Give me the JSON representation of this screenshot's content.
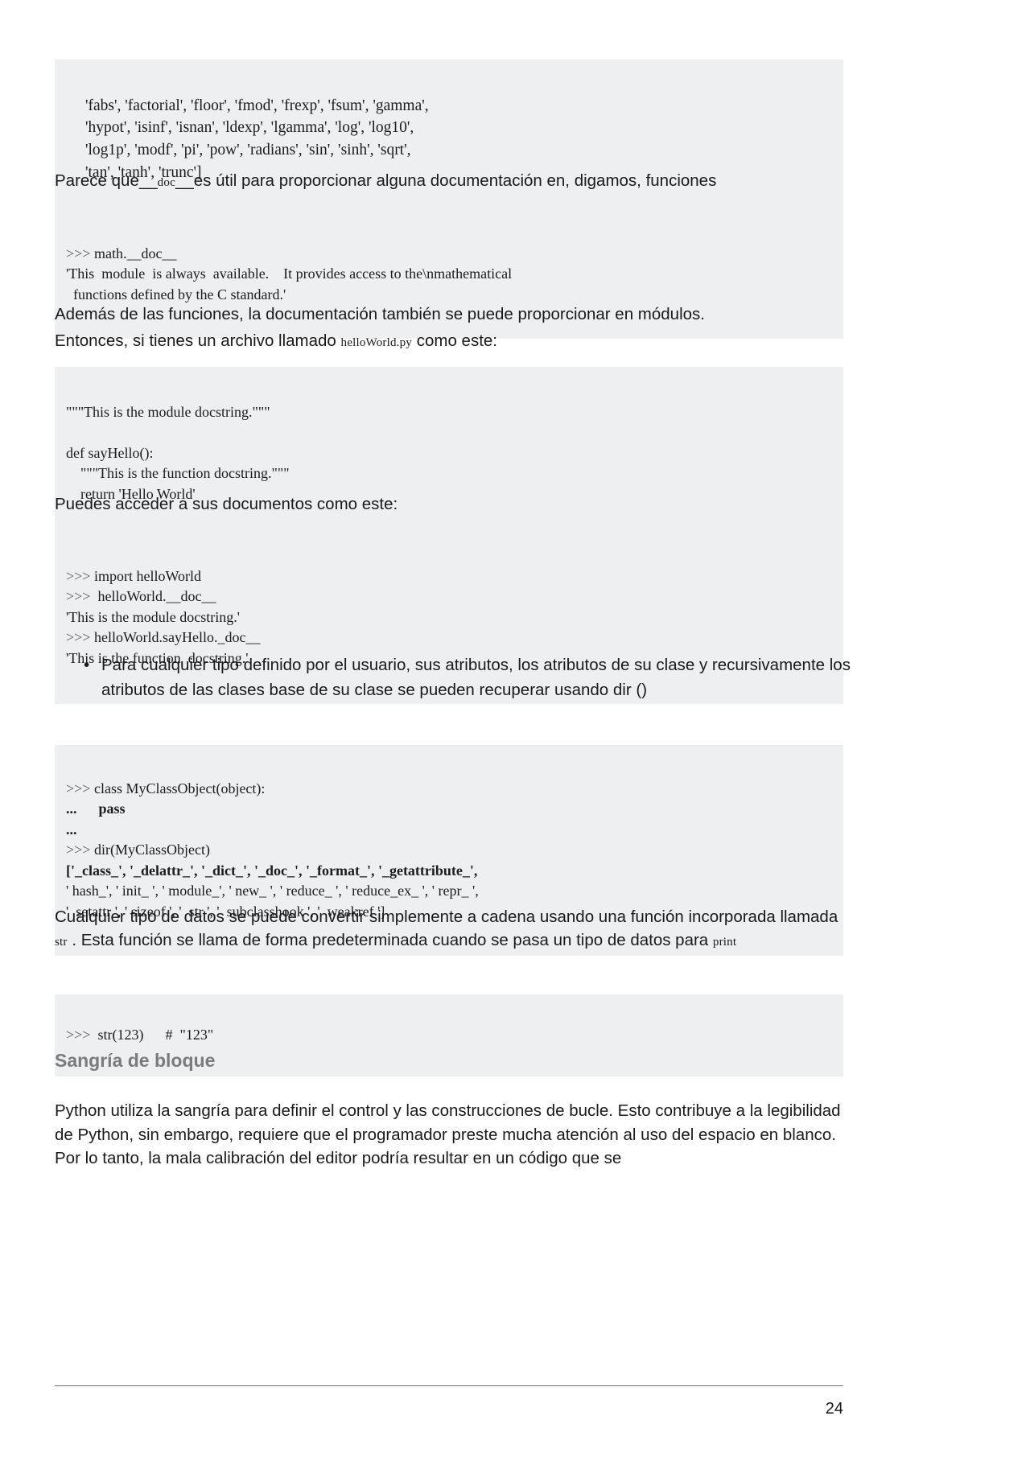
{
  "document": {
    "page_number": "24",
    "colors": {
      "code_background": "#edeff0",
      "heading_gray": "#7b7b7b",
      "body_text": "#1a1a1a",
      "rule": "#6f6f6f"
    }
  },
  "blocks": {
    "math_dir_listing": {
      "lines": [
        "'fabs', 'factorial', 'floor', 'fmod', 'frexp', 'fsum', 'gamma',",
        "'hypot', 'isinf', 'isnan', 'ldexp', 'lgamma', 'log', 'log10',",
        "'log1p', 'modf', 'pi', 'pow', 'radians', 'sin', 'sinh', 'sqrt',",
        "'tan', 'tanh', 'trunc']"
      ]
    },
    "math_doc": {
      "prompt": ">>>",
      "command": "math.__doc__",
      "output_line_1": "'This  module  is always  available.    It provides access to the\\nmathematical",
      "output_line_2": "functions defined by the C standard.'"
    },
    "hello_world_module": {
      "line_1": "\"\"\"This is the module docstring.\"\"\"",
      "line_2": "",
      "line_3": "def sayHello():",
      "line_4": "    \"\"\"This is the function docstring.\"\"\"",
      "line_5": "    return 'Hello World'"
    },
    "hello_world_docs": {
      "line_1_prompt": ">>>",
      "line_1_cmd": "import helloWorld",
      "line_2_prompt": ">>>",
      "line_2_cmd": "helloWorld.__doc__",
      "line_3_out": "'This is the module docstring.'",
      "line_4_prompt": ">>>",
      "line_4_cmd": "helloWorld.sayHello._doc__",
      "line_5_out": "'This is the function  docstring.'"
    },
    "dir_myclassobject": {
      "line_1_prompt": ">>>",
      "line_1_cmd": "class MyClassObject(object):",
      "line_2_prompt": "...",
      "line_2_cmd": "pass",
      "line_3_prompt": "...",
      "line_4_prompt": ">>>",
      "line_4_cmd": "dir(MyClassObject)",
      "out_line_1": "['_class_', '_delattr_', '_dict_', '_doc_', '_format_', '_getattribute_',",
      "out_line_2": "' hash_', ' init_ ', ' module_', ' new_ ', ' reduce_ ', ' reduce_ex_ ', ' repr_ ',",
      "out_line_3": "'  setattr ', ' sizeof ', '  str ', '  subclasshook ', '  weakref ']"
    },
    "str_example": {
      "prompt": ">>>",
      "command": "str(123)",
      "comment": "#  \"123\""
    }
  },
  "paragraphs": {
    "p1_part1": "Parece que",
    "p1_underscores_left": "__",
    "p1_mono": "doc",
    "p1_underscores_right": "__",
    "p1_part2": "es útil para proporcionar alguna documentación en, digamos, funciones",
    "p2_line1": "Además de las funciones, la documentación también se puede proporcionar en módulos.",
    "p2_line2_a": "Entonces, si tienes un archivo llamado",
    "p2_line2_mono": "helloWorld.py",
    "p2_line2_b": "como este:",
    "p3": "Puedes acceder a sus documentos como este:",
    "bullet_1": "Para cualquier tipo definido por el usuario, sus atributos, los atributos de su clase y recursivamente los atributos de las clases base de su clase se pueden recuperar usando dir ()",
    "p4_a": "Cualquier tipo de datos se puede convertir simplemente a cadena usando una función incorporada llamada",
    "p4_mono1": "str",
    "p4_b": ". Esta función se llama de forma predeterminada cuando se pasa un tipo de datos para",
    "p4_mono2": "print",
    "section_heading": "Sangría de bloque",
    "p5": "Python utiliza la sangría para definir el control y las construcciones de bucle. Esto contribuye a la legibilidad de Python, sin embargo, requiere que el programador preste mucha atención al uso del espacio en blanco. Por lo tanto, la mala calibración del editor podría resultar en un código que se"
  }
}
